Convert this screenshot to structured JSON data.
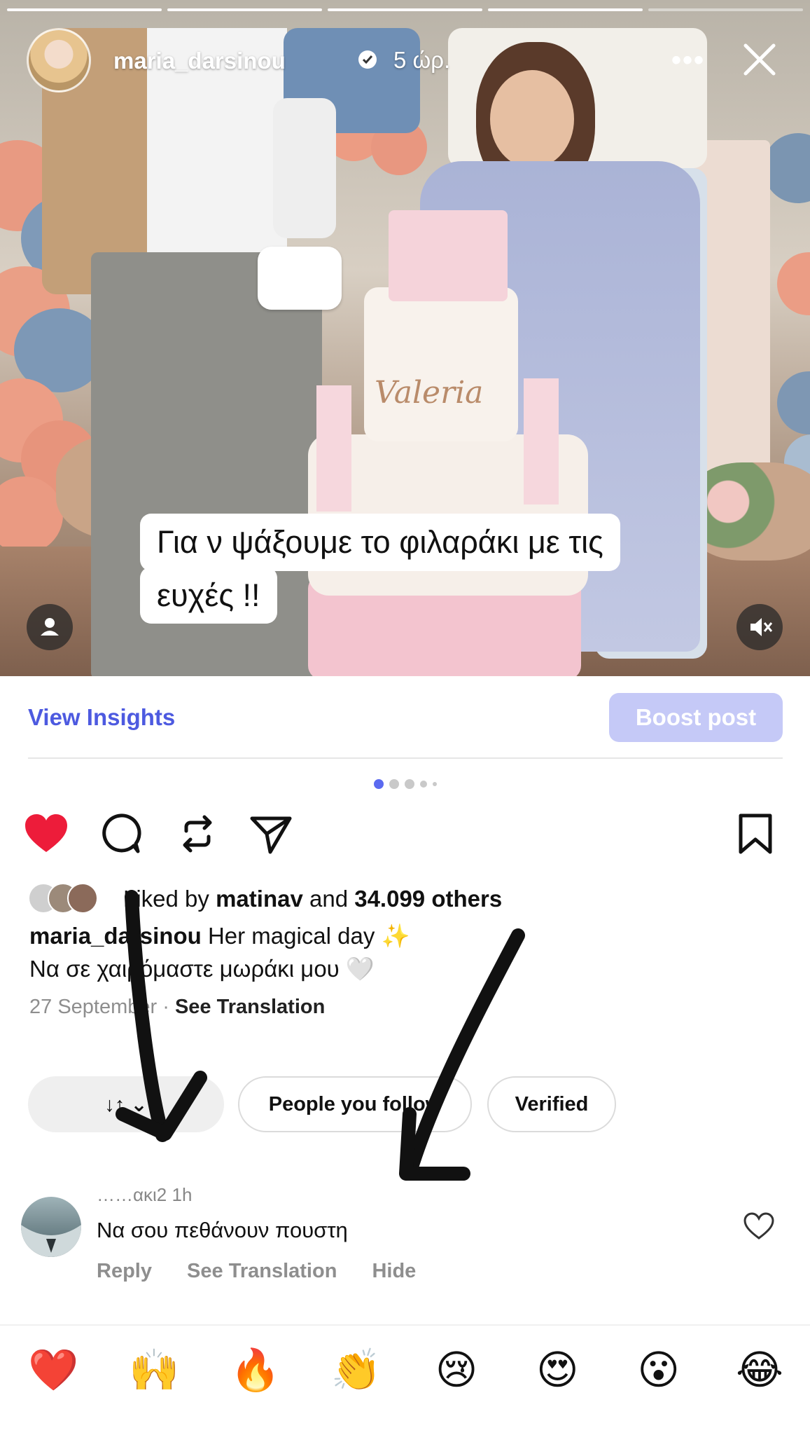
{
  "story": {
    "username": "maria_darsinou",
    "time": "5 ώρ.",
    "caption_line1": "Για ν ψάξουμε το φιλαράκι με τις",
    "caption_line2": "ευχές !!",
    "progress_segments": 5,
    "progress_done": 4
  },
  "post": {
    "insights_label": "View Insights",
    "boost_label": "Boost post",
    "liked_prefix": "Liked by",
    "liked_user": "matinav",
    "liked_and": "and",
    "liked_count": "34.099 others",
    "caption_user": "maria_darsinou",
    "caption_text": "Her magical day ✨",
    "caption_line2": "Να σε χαιρόμαστε μωράκι μου 🤍",
    "date": "27 September",
    "see_translation": "See Translation",
    "cake_text": "Valeria"
  },
  "filters": {
    "sort_label": "↓↑ ⌄",
    "people_label": "People you follow",
    "verified_label": "Verified"
  },
  "comment": {
    "user": "……ακι2 1h",
    "text": "Να σου πεθάνουν πουστη",
    "reply": "Reply",
    "see_translation": "See Translation",
    "hide": "Hide"
  },
  "reactions": [
    "❤️",
    "🙌",
    "🔥",
    "👏",
    "😢",
    "😍",
    "😮",
    "😂"
  ],
  "colors": {
    "accent": "#4d5ae0",
    "boost_bg": "#c5c9f7",
    "heart": "#ed1c3a"
  }
}
